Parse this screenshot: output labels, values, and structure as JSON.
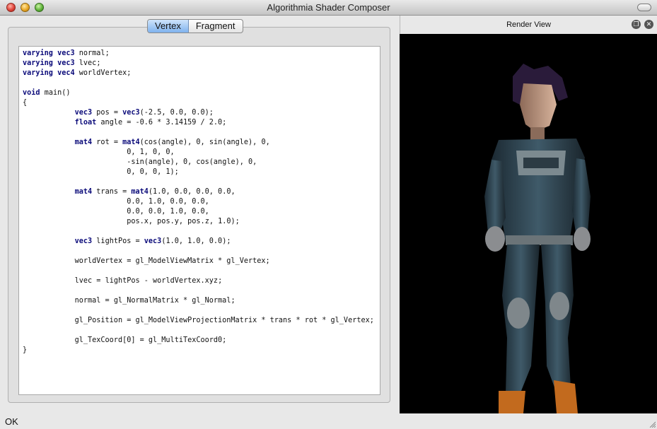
{
  "window": {
    "title": "Algorithmia Shader Composer"
  },
  "editor": {
    "tabs": [
      {
        "label": "Vertex",
        "active": true
      },
      {
        "label": "Fragment",
        "active": false
      }
    ],
    "code_lines": [
      "varying vec3 normal;",
      "varying vec3 lvec;",
      "varying vec4 worldVertex;",
      "",
      "void main()",
      "{",
      "            vec3 pos = vec3(-2.5, 0.0, 0.0);",
      "            float angle = -0.6 * 3.14159 / 2.0;",
      "",
      "            mat4 rot = mat4(cos(angle), 0, sin(angle), 0,",
      "                        0, 1, 0, 0,",
      "                        -sin(angle), 0, cos(angle), 0,",
      "                        0, 0, 0, 1);",
      "",
      "            mat4 trans = mat4(1.0, 0.0, 0.0, 0.0,",
      "                        0.0, 1.0, 0.0, 0.0,",
      "                        0.0, 0.0, 1.0, 0.0,",
      "                        pos.x, pos.y, pos.z, 1.0);",
      "",
      "            vec3 lightPos = vec3(1.0, 1.0, 0.0);",
      "",
      "            worldVertex = gl_ModelViewMatrix * gl_Vertex;",
      "",
      "            lvec = lightPos - worldVertex.xyz;",
      "",
      "            normal = gl_NormalMatrix * gl_Normal;",
      "",
      "            gl_Position = gl_ModelViewProjectionMatrix * trans * rot * gl_Vertex;",
      "",
      "            gl_TexCoord[0] = gl_MultiTexCoord0;",
      "}"
    ],
    "keywords": [
      "varying",
      "vec3",
      "vec4",
      "void",
      "float",
      "mat4"
    ]
  },
  "render": {
    "title": "Render View"
  },
  "status": {
    "text": "OK"
  }
}
